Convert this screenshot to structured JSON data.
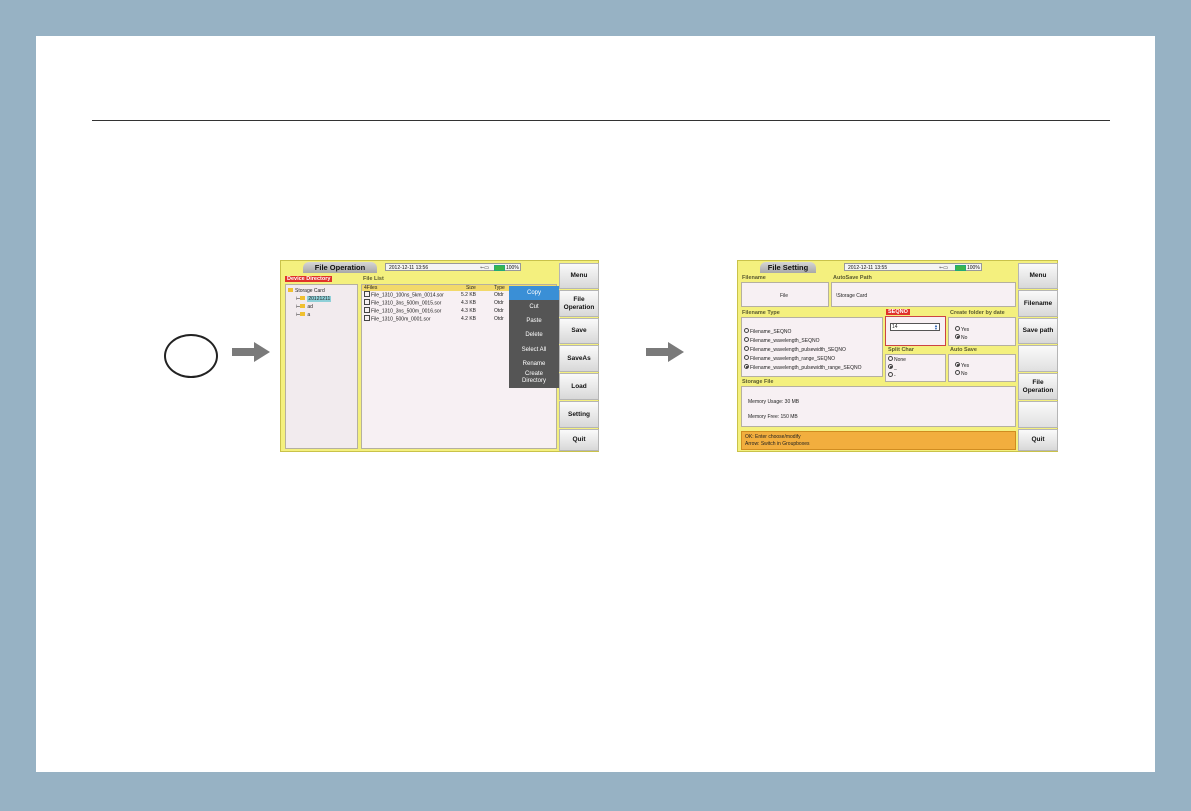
{
  "screen1": {
    "title": "File Operation",
    "datetime": "2012-12-11 13:56",
    "battery": "100%",
    "device_directory_label": "Device Directory",
    "file_list_label": "File List",
    "tree": {
      "root": "Storage Card",
      "children": [
        "20121211",
        "ad",
        "a"
      ]
    },
    "list_header": {
      "count": "4Files",
      "size": "Size",
      "type": "Type"
    },
    "files": [
      {
        "name": "File_1310_100ns_5km_0014.sor",
        "size": "5.2 KB",
        "type": "Otdr"
      },
      {
        "name": "File_1310_3ns_500m_0015.sor",
        "size": "4.3 KB",
        "type": "Otdr"
      },
      {
        "name": "File_1310_3ns_500m_0016.sor",
        "size": "4.3 KB",
        "type": "Otdr"
      },
      {
        "name": "File_1310_500m_0001.sor",
        "size": "4.2 KB",
        "type": "Otdr"
      }
    ],
    "context_menu": [
      "Copy",
      "Cut",
      "Paste",
      "Delete",
      "Select All",
      "Rename",
      "Create Directory"
    ],
    "side_buttons": [
      "Menu",
      "File Operation",
      "Save",
      "SaveAs",
      "Load",
      "Setting",
      "Quit"
    ]
  },
  "screen2": {
    "title": "File Setting",
    "datetime": "2012-12-11 13:55",
    "battery": "100%",
    "filename_label": "Filename",
    "filename_value": "File",
    "autosave_label": "AutoSave Path",
    "autosave_value": "\\Storage Card",
    "filename_type_label": "Filename Type",
    "filename_types": [
      "Filename_SEQNO",
      "Filename_wavelength_SEQNO",
      "Filename_wavelength_pulsewidth_SEQNO",
      "Filename_wavelength_range_SEQNO",
      "Filename_wavelength_pulsewidth_range_SEQNO"
    ],
    "seqno_label": "SEQNO",
    "seqno_value": "14",
    "create_folder_label": "Create folder by date",
    "create_folder_options": [
      "Yes",
      "No"
    ],
    "split_char_label": "Split Char",
    "split_char_options": [
      "None",
      "_",
      "-"
    ],
    "auto_save_label": "Auto Save",
    "auto_save_options": [
      "Yes",
      "No"
    ],
    "storage_label": "Storage File",
    "memory_usage": "Memory Usage: 30 MB",
    "memory_free": "Memory Free: 150 MB",
    "hint_line1": "OK: Enter choose/modify",
    "hint_line2": "Arrow: Switch in Groupboxes",
    "side_buttons": [
      "Menu",
      "Filename",
      "Save path",
      "",
      "File Operation",
      "",
      "Quit"
    ]
  },
  "colors": {
    "screen_bg": "#f4f07e",
    "accent_red": "#e0322b",
    "menu_selected": "#3a8fd6",
    "hint_bg": "#f2ae3e"
  }
}
